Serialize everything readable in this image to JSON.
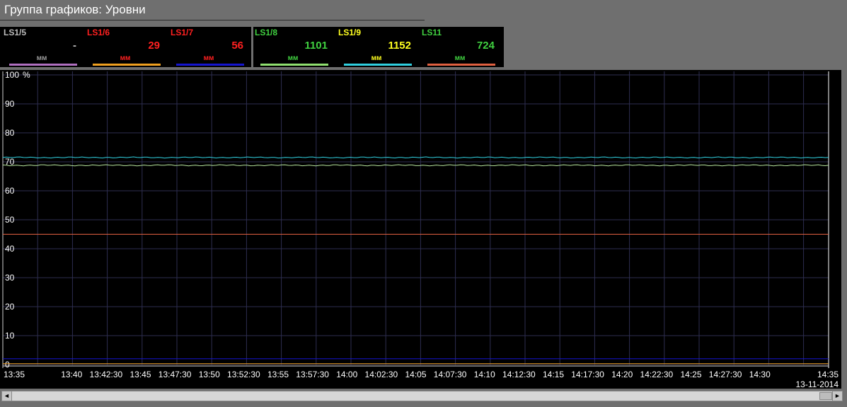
{
  "window": {
    "title": "Группа графиков: Уровни"
  },
  "legend": {
    "channels": [
      {
        "name": "LS1/5",
        "value": "-",
        "unit": "мм",
        "name_color": "#bdbdbd",
        "value_color": "#bdbdbd",
        "unit_color": "#9a9a9a",
        "line_color": "#b070c0"
      },
      {
        "name": "LS1/6",
        "value": "29",
        "unit": "мм",
        "name_color": "#ff2020",
        "value_color": "#ff2020",
        "unit_color": "#ff2020",
        "line_color": "#f0a020"
      },
      {
        "name": "LS1/7",
        "value": "56",
        "unit": "мм",
        "name_color": "#ff2020",
        "value_color": "#ff2020",
        "unit_color": "#ff2020",
        "line_color": "#1515d0"
      },
      {
        "name": "LS1/8",
        "value": "1101",
        "unit": "мм",
        "name_color": "#40d040",
        "value_color": "#40d040",
        "unit_color": "#40d040",
        "line_color": "#90e070"
      },
      {
        "name": "LS1/9",
        "value": "1152",
        "unit": "мм",
        "name_color": "#ffff20",
        "value_color": "#ffff20",
        "unit_color": "#ffff20",
        "line_color": "#30d0e0"
      },
      {
        "name": "LS11",
        "value": "724",
        "unit": "мм",
        "name_color": "#40d040",
        "value_color": "#40d040",
        "unit_color": "#40d040",
        "line_color": "#e06040"
      }
    ]
  },
  "chart_data": {
    "type": "line",
    "y_unit": "%",
    "ylim": [
      0,
      100
    ],
    "y_ticks": [
      "100",
      "90",
      "80",
      "70",
      "60",
      "50",
      "40",
      "30",
      "20",
      "10",
      "0"
    ],
    "x_ticks": [
      "13:35",
      "13:40",
      "13:42:30",
      "13:45",
      "13:47:30",
      "13:50",
      "13:52:30",
      "13:55",
      "13:57:30",
      "14:00",
      "14:02:30",
      "14:05",
      "14:07:30",
      "14:10",
      "14:12:30",
      "14:15",
      "14:17:30",
      "14:20",
      "14:22:30",
      "14:25",
      "14:27:30",
      "14:30",
      "14:35"
    ],
    "date": "13-11-2014",
    "grid": true,
    "series": [
      {
        "name": "LS1/9",
        "color": "#30d0e0",
        "level": 71.5
      },
      {
        "name": "LS1/8",
        "color": "#b8e8a0",
        "level": 68.8
      },
      {
        "name": "LS11",
        "color": "#e06040",
        "level": 45.0
      },
      {
        "name": "LS1/7",
        "color": "#1515d0",
        "level": 2.0
      },
      {
        "name": "LS1/6",
        "color": "#f0a020",
        "level": 0.3
      }
    ]
  },
  "scrollbar": {
    "left_arrow": "◄",
    "right_arrow": "►"
  }
}
